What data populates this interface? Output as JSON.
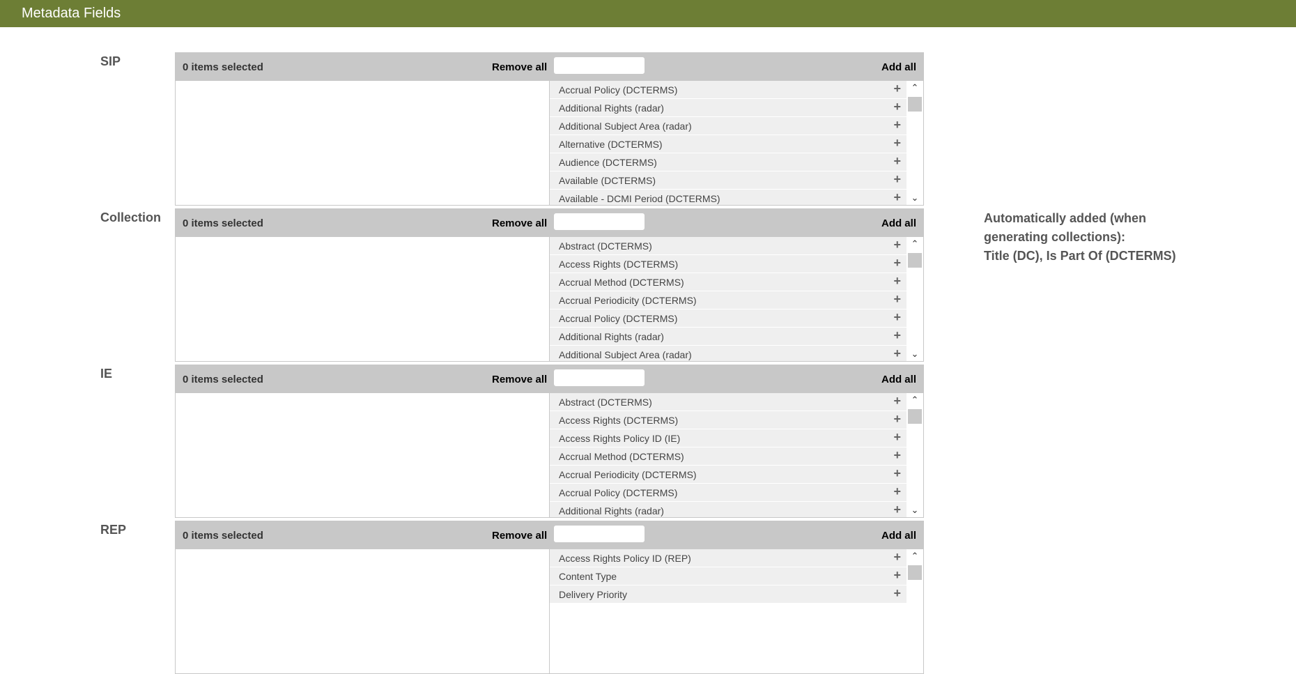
{
  "header": {
    "title": "Metadata Fields"
  },
  "sections": [
    {
      "label": "SIP",
      "selected_text": "0 items selected",
      "remove_all": "Remove all",
      "add_all": "Add all",
      "items": [
        "Accrual Policy (DCTERMS)",
        "Additional Rights (radar)",
        "Additional Subject Area (radar)",
        "Alternative (DCTERMS)",
        "Audience (DCTERMS)",
        "Available (DCTERMS)",
        "Available - DCMI Period (DCTERMS)"
      ]
    },
    {
      "label": "Collection",
      "selected_text": "0 items selected",
      "remove_all": "Remove all",
      "add_all": "Add all",
      "items": [
        "Abstract (DCTERMS)",
        "Access Rights (DCTERMS)",
        "Accrual Method (DCTERMS)",
        "Accrual Periodicity (DCTERMS)",
        "Accrual Policy (DCTERMS)",
        "Additional Rights (radar)",
        "Additional Subject Area (radar)"
      ]
    },
    {
      "label": "IE",
      "selected_text": "0 items selected",
      "remove_all": "Remove all",
      "add_all": "Add all",
      "items": [
        "Abstract (DCTERMS)",
        "Access Rights (DCTERMS)",
        "Access Rights Policy ID (IE)",
        "Accrual Method (DCTERMS)",
        "Accrual Periodicity (DCTERMS)",
        "Accrual Policy (DCTERMS)",
        "Additional Rights (radar)"
      ]
    },
    {
      "label": "REP",
      "selected_text": "0 items selected",
      "remove_all": "Remove all",
      "add_all": "Add all",
      "items": [
        "Access Rights Policy ID (REP)",
        "Content Type",
        "Delivery Priority"
      ]
    }
  ],
  "info": {
    "line1": "Automatically added (when generating collections):",
    "line2": "Title (DC), Is Part Of (DCTERMS)"
  },
  "icons": {
    "add_item": "plus-icon",
    "scroll_up": "chevron-up-icon",
    "scroll_down": "chevron-down-icon"
  },
  "colors": {
    "header_bg": "#6d7e35",
    "panel_header_bg": "#c8c8c8",
    "item_bg": "#efefef"
  }
}
